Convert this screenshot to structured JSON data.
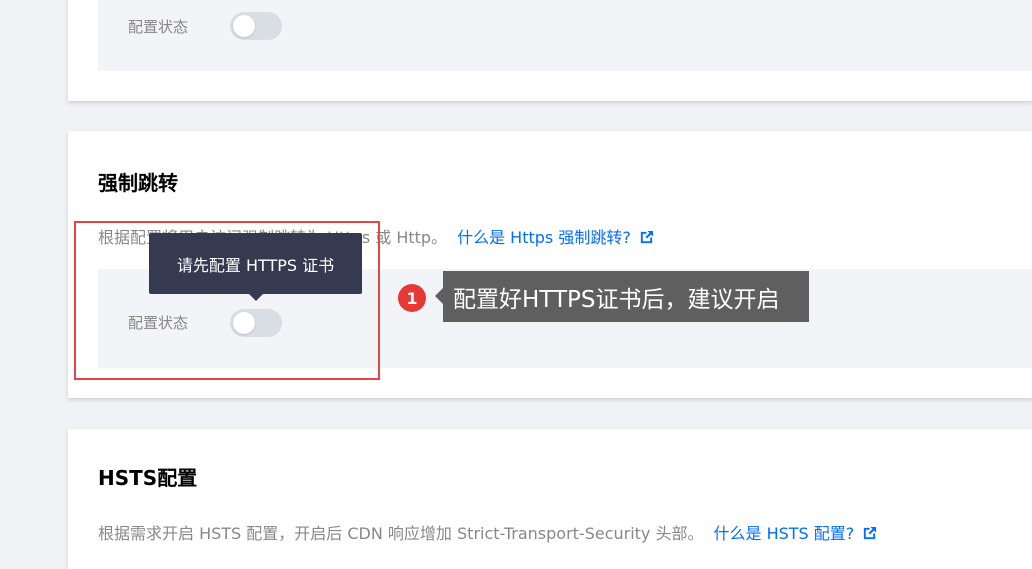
{
  "section1": {
    "config_label": "配置状态"
  },
  "section2": {
    "title": "强制跳转",
    "desc_prefix": "根据配置将用户访问强制跳转为 Https 或 Http。",
    "link": "什么是 Https 强制跳转?",
    "config_label": "配置状态",
    "tooltip": "请先配置 HTTPS 证书"
  },
  "section3": {
    "title": "HSTS配置",
    "desc_prefix": "根据需求开启 HSTS 配置，开启后 CDN 响应增加 Strict-Transport-Security 头部。",
    "link": "什么是 HSTS 配置?"
  },
  "annotation": {
    "number": "1",
    "text": "配置好HTTPS证书后，建议开启"
  },
  "colors": {
    "accent": "#006eff",
    "annotation_red": "#e53935",
    "tooltip_bg": "#363a50",
    "callout_bg": "#5f5f5f"
  },
  "icons": {
    "external_link": "external-link-icon"
  }
}
